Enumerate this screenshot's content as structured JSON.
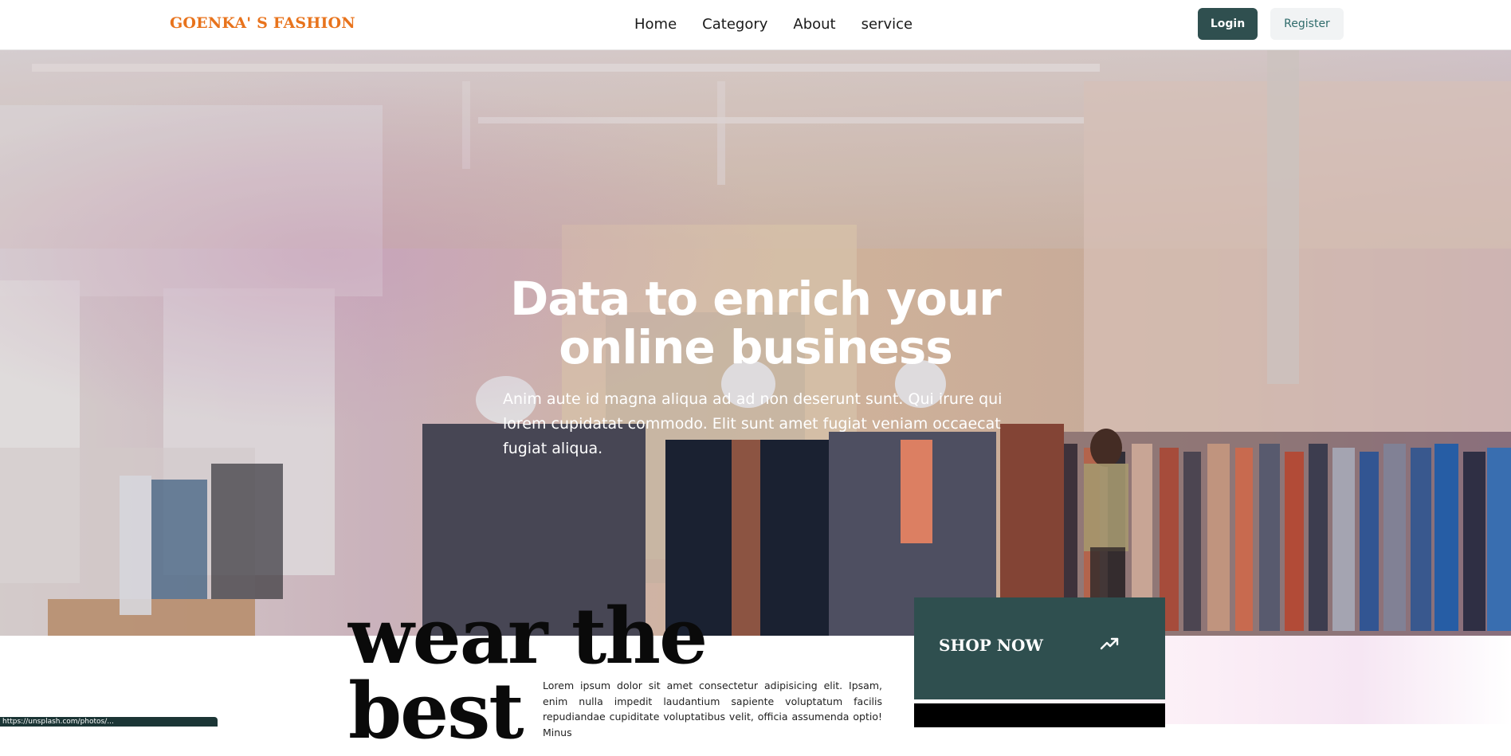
{
  "brand": "GOENKA' S FASHION",
  "nav": {
    "items": [
      "Home",
      "Category",
      "About",
      "service"
    ],
    "login": "Login",
    "register": "Register"
  },
  "hero": {
    "title_line1": "Data to enrich your",
    "title_line2": "online business",
    "subtitle": "Anim aute id magna aliqua ad ad non deserunt sunt. Qui irure qui lorem cupidatat commodo. Elit sunt amet fugiat veniam occaecat fugiat aliqua."
  },
  "section": {
    "heading_line1": "wear the",
    "heading_line2": "best",
    "body": "Lorem ipsum dolor sit amet consectetur adipisicing elit. Ipsam, enim nulla impedit laudantium sapiente voluptatum facilis repudiandae cupiditate voluptatibus velit, officia assumenda optio! Minus",
    "shop_label": "SHOP NOW",
    "shop_icon": "trending-up-icon"
  },
  "status_bar": {
    "url": "https://unsplash.com/photos/..."
  },
  "colors": {
    "brand": "#e8731c",
    "primary": "#2f4f4f",
    "register_bg": "#f1f3f4"
  }
}
